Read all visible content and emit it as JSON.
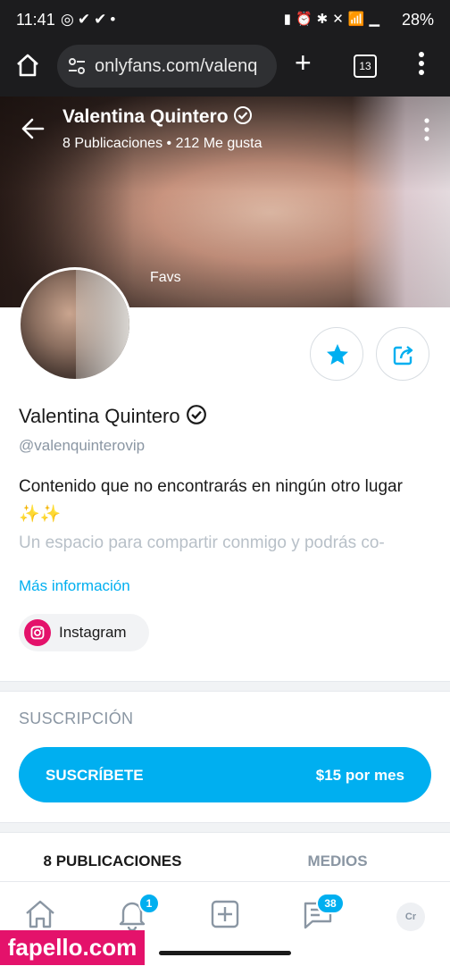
{
  "status_bar": {
    "time": "11:41",
    "battery": "28%"
  },
  "browser": {
    "url": "onlyfans.com/valenq",
    "tab_count": "13"
  },
  "cover": {
    "name": "Valentina Quintero",
    "stats": "8 Publicaciones  •  212 Me gusta",
    "label": "Favs"
  },
  "profile": {
    "name": "Valentina Quintero",
    "handle": "@valenquinterovip",
    "bio_line1": "Contenido que no encontrarás en ningún otro lugar ✨✨",
    "bio_line2": "Un espacio para compartir conmigo y podrás co-",
    "more_link": "Más información",
    "social_chip": "Instagram"
  },
  "subscription": {
    "section_title": "SUSCRIPCIÓN",
    "button_label": "SUSCRÍBETE",
    "price": "$15 por mes"
  },
  "tabs": [
    {
      "label": "8 PUBLICACIONES"
    },
    {
      "label": "MEDIOS"
    }
  ],
  "bottom_nav": {
    "notifications_badge": "1",
    "messages_badge": "38",
    "avatar_initials": "Cr"
  },
  "watermark": "fapello.com",
  "colors": {
    "accent": "#00aff0",
    "instagram": "#e4126b",
    "muted": "#8a96a3"
  }
}
